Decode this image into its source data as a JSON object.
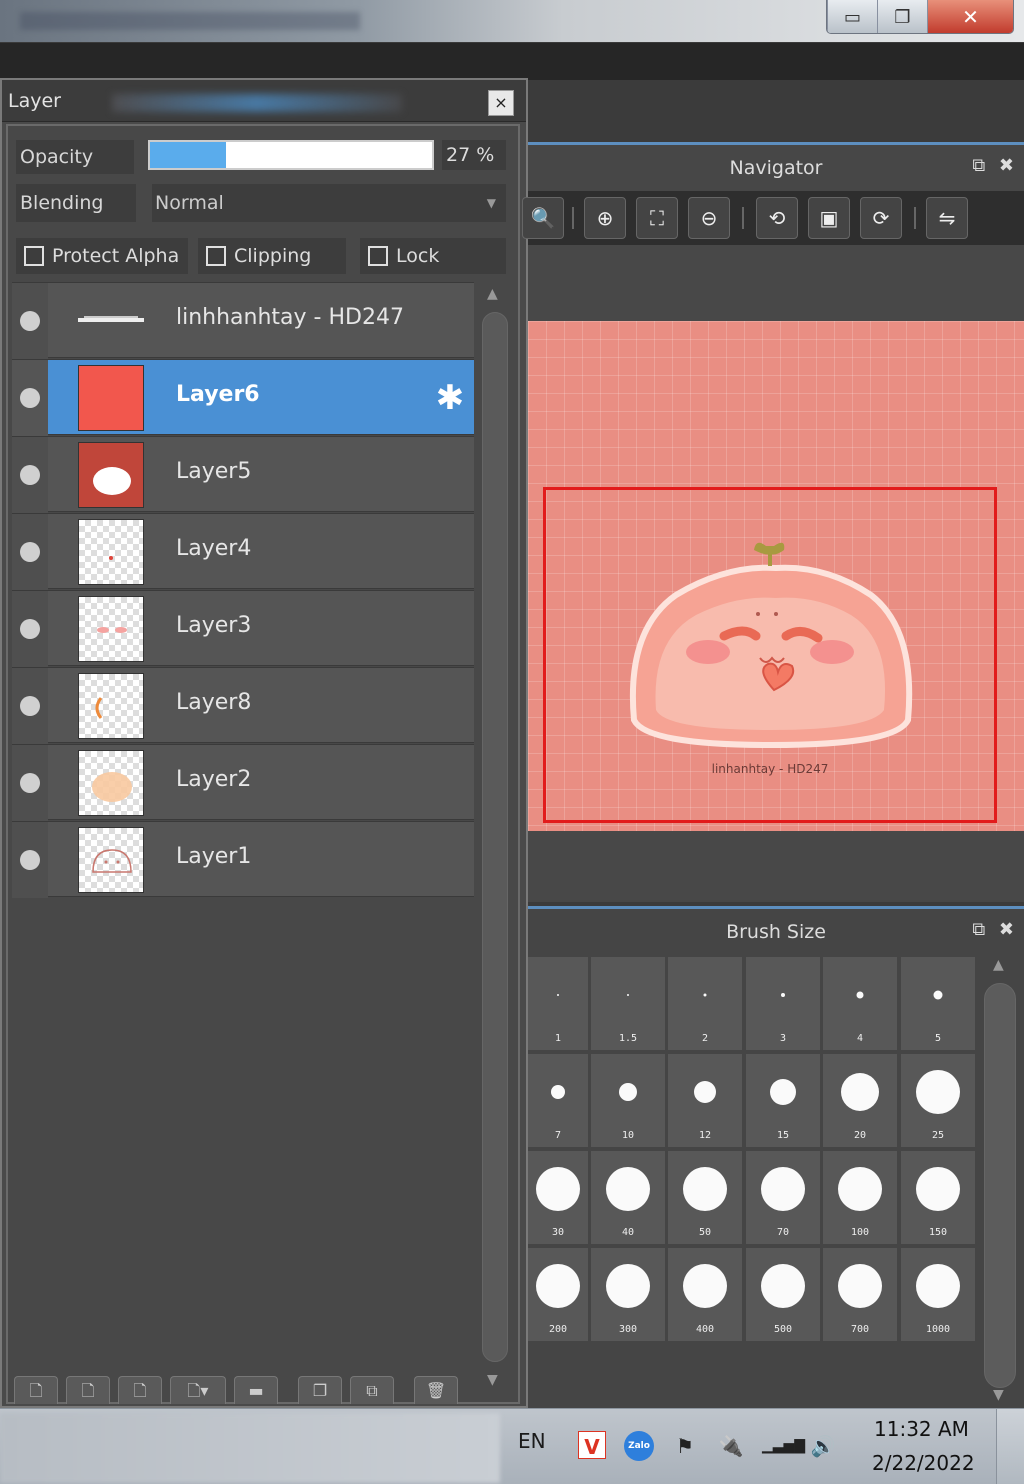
{
  "window_controls": {
    "minimize": "▭",
    "restore": "❐",
    "close": "✕"
  },
  "layer_panel": {
    "title": "Layer",
    "close": "×",
    "opacity": {
      "label": "Opacity",
      "value": "27 %",
      "fraction": 0.27
    },
    "blending": {
      "label": "Blending",
      "value": "Normal"
    },
    "checkboxes": [
      "Protect Alpha",
      "Clipping",
      "Lock"
    ],
    "layers": [
      {
        "name": "linhhanhtay - HD247",
        "thumb": "text-strip"
      },
      {
        "name": "Layer6",
        "thumb": "red-fill",
        "selected": true
      },
      {
        "name": "Layer5",
        "thumb": "white-bun"
      },
      {
        "name": "Layer4",
        "thumb": "red-dot"
      },
      {
        "name": "Layer3",
        "thumb": "pink-cheeks"
      },
      {
        "name": "Layer8",
        "thumb": "orange-arc"
      },
      {
        "name": "Layer2",
        "thumb": "peach-blob"
      },
      {
        "name": "Layer1",
        "thumb": "bun-outline"
      }
    ],
    "settings_glyph": "✱",
    "toolbar": [
      "new-layer",
      "new-halftone-layer",
      "new-1bit-layer",
      "add-menu",
      "new-folder",
      "duplicate",
      "merge",
      "delete"
    ],
    "toolbar_glyphs": [
      "🗋",
      "🗋",
      "🗋",
      "🗋▾",
      "▬",
      "❐",
      "⧉",
      "🗑"
    ]
  },
  "navigator": {
    "title": "Navigator",
    "popout": "⧉",
    "close": "✖",
    "tools": [
      "zoom-fit-icon",
      "zoom-in-icon",
      "fit-window-icon",
      "zoom-out-icon",
      "rotate-left-icon",
      "actual-size-icon",
      "rotate-right-icon",
      "flip-icon"
    ],
    "tool_glyphs": [
      "🔍",
      "⊕",
      "⛶",
      "⊖",
      "⟲",
      "▣",
      "⟳",
      "⇋"
    ],
    "caption": "linhanhtay - HD247"
  },
  "brush_size": {
    "title": "Brush Size",
    "popout": "⧉",
    "close": "✖",
    "sizes": [
      "1",
      "1.5",
      "2",
      "3",
      "4",
      "5",
      "7",
      "10",
      "12",
      "15",
      "20",
      "25",
      "30",
      "40",
      "50",
      "70",
      "100",
      "150",
      "200",
      "300",
      "400",
      "500",
      "700",
      "1000"
    ]
  },
  "taskbar": {
    "language": "EN",
    "tray_v": "V",
    "tray_zalo": "Zalo",
    "tray_flag": "⚑",
    "tray_power": "🔌",
    "tray_signal": "▁▃▅▇",
    "tray_volume": "🔊",
    "time": "11:32 AM",
    "date": "2/22/2022"
  },
  "colors": {
    "accent": "#4a90d4",
    "canvas_pink": "#e98e83",
    "viewport_red": "#e21b1b",
    "opacity_fill": "#5aacec"
  }
}
